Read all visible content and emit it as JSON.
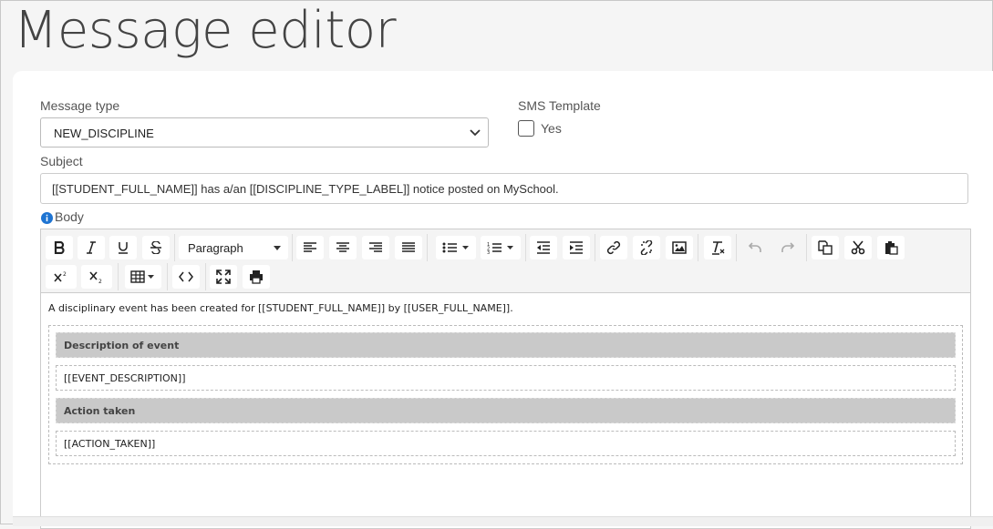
{
  "page": {
    "title": "Message editor"
  },
  "form": {
    "message_type_label": "Message type",
    "message_type_value": "NEW_DISCIPLINE",
    "sms_template_label": "SMS Template",
    "sms_template_option": "Yes",
    "subject_label": "Subject",
    "subject_value": "[[STUDENT_FULL_NAME]] has a/an [[DISCIPLINE_TYPE_LABEL]] notice posted on MySchool.",
    "body_label": "Body"
  },
  "toolbar": {
    "paragraph_value": "Paragraph",
    "icons": [
      "bold-icon",
      "italic-icon",
      "underline-icon",
      "strikethrough-icon",
      "align-left-icon",
      "align-center-icon",
      "align-right-icon",
      "align-justify-icon",
      "bullet-list-icon",
      "numbered-list-icon",
      "outdent-icon",
      "indent-icon",
      "link-icon",
      "unlink-icon",
      "image-icon",
      "clear-format-icon",
      "undo-icon",
      "redo-icon",
      "copy-icon",
      "cut-icon",
      "paste-icon",
      "superscript-icon",
      "subscript-icon",
      "table-icon",
      "source-code-icon",
      "fullscreen-icon",
      "print-icon"
    ]
  },
  "body_content": {
    "intro": "A disciplinary event has been created for [[STUDENT_FULL_NAME]] by [[USER_FULL_NAME]].",
    "rows": [
      {
        "header": "Description of event",
        "value": "[[EVENT_DESCRIPTION]]"
      },
      {
        "header": "Action taken",
        "value": "[[ACTION_TAKEN]]"
      }
    ]
  },
  "colors": {
    "info_icon": "#1e74d2",
    "header_cell_bg": "#c9c9c9",
    "toolbar_bg": "#f4f4f4"
  }
}
